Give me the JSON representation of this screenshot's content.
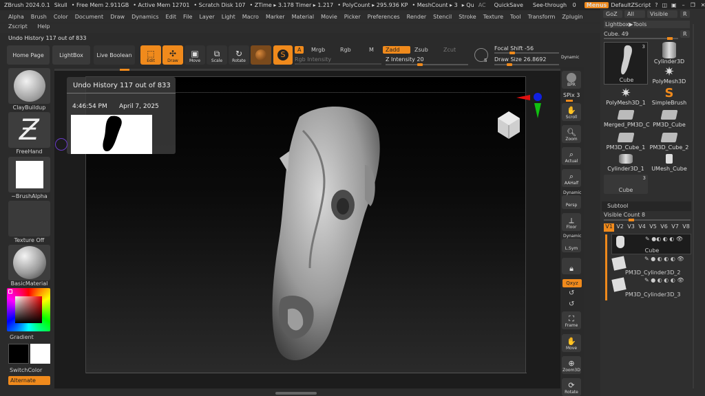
{
  "titlebar": {
    "app": "ZBrush 2024.0.1",
    "document": "Skull",
    "free_mem": "• Free Mem 2.911GB",
    "active_mem": "• Active Mem 12701",
    "scratch_disk": "• Scratch Disk 107",
    "ztime": "• ZTime ▸ 3.178 Timer ▸ 1.217",
    "polycount": "• PolyCount ▸ 295.936 KP",
    "meshcount": "• MeshCount ▸ 3",
    "qu": "▸ Qu",
    "ac": "AC",
    "quicksave": "QuickSave",
    "see_through": "See-through",
    "see_through_value": "0",
    "menus": "Menus",
    "default_zscript": "DefaultZScript"
  },
  "menus": [
    "Alpha",
    "Brush",
    "Color",
    "Document",
    "Draw",
    "Dynamics",
    "Edit",
    "File",
    "Layer",
    "Light",
    "Macro",
    "Marker",
    "Material",
    "Movie",
    "Picker",
    "Preferences",
    "Render",
    "Stencil",
    "Stroke",
    "Texture",
    "Tool",
    "Transform",
    "Zplugin"
  ],
  "menus2": [
    "Zscript",
    "Help"
  ],
  "status": "Undo History 117 out of 833",
  "shelf": {
    "home_page": "Home Page",
    "lightbox": "LightBox",
    "live_boolean": "Live Boolean",
    "edit": "Edit",
    "draw": "Draw",
    "move": "Move",
    "scale": "Scale",
    "rotate": "Rotate",
    "a": "A",
    "mrgb": "Mrgb",
    "rgb": "Rgb",
    "m": "M",
    "zadd": "Zadd",
    "zsub": "Zsub",
    "zcut": "Zcut",
    "rgb_intensity": "Rgb Intensity",
    "z_intensity": "Z Intensity 20",
    "focal_shift": "Focal Shift -56",
    "draw_size": "Draw Size 26.8692",
    "dynamic": "Dynamic",
    "s": "S"
  },
  "left_panel": {
    "brush": "ClayBuildup",
    "stroke": "FreeHand",
    "alpha": "~BrushAlpha",
    "texture": "Texture Off",
    "material": "BasicMaterial",
    "gradient": "Gradient",
    "switch_color": "SwitchColor",
    "alternate": "Alternate"
  },
  "undo_popup": {
    "title": "Undo History 117 out of 833",
    "time": "4:46:54 PM",
    "date": "April 7, 2025"
  },
  "right_strip": {
    "bpr": "BPR",
    "spix": "SPix 3",
    "scroll": "Scroll",
    "zoom": "Zoom",
    "actual": "Actual",
    "aahalf": "AAHalf",
    "dynamic_persp": "Dynamic",
    "persp": "Persp",
    "floor": "Floor",
    "dynamic_lsym": "Dynamic",
    "lsym": "L.Sym",
    "xyz": "Qxyz",
    "frame": "Frame",
    "move": "Move",
    "zoom3d": "Zoom3D",
    "rotate": "Rotate"
  },
  "tool_panel": {
    "goz": "GoZ",
    "all": "All",
    "visible": "Visible",
    "r": "R",
    "lightbox_tools": "Lightbox▶Tools",
    "cube_label": "Cube. 49",
    "r2": "R",
    "items": [
      {
        "label": "Cube",
        "count": "3"
      },
      {
        "label": "Cylinder3D"
      },
      {
        "label": "PolyMesh3D"
      },
      {
        "label": "PolyMesh3D_1"
      },
      {
        "label": "SimpleBrush"
      },
      {
        "label": "Merged_PM3D_C"
      },
      {
        "label": "PM3D_Cube"
      },
      {
        "label": "PM3D_Cube_1"
      },
      {
        "label": "PM3D_Cube_2"
      },
      {
        "label": "Cylinder3D_1"
      },
      {
        "label": "UMesh_Cube"
      },
      {
        "label": "Cube",
        "count": "3"
      }
    ],
    "subtool": "Subtool",
    "visible_count": "Visible Count 8",
    "versions": [
      "V1",
      "V2",
      "V3",
      "V4",
      "V5",
      "V6",
      "V7",
      "V8"
    ],
    "subtools": [
      "Cube",
      "PM3D_Cylinder3D_2",
      "PM3D_Cylinder3D_3"
    ]
  }
}
